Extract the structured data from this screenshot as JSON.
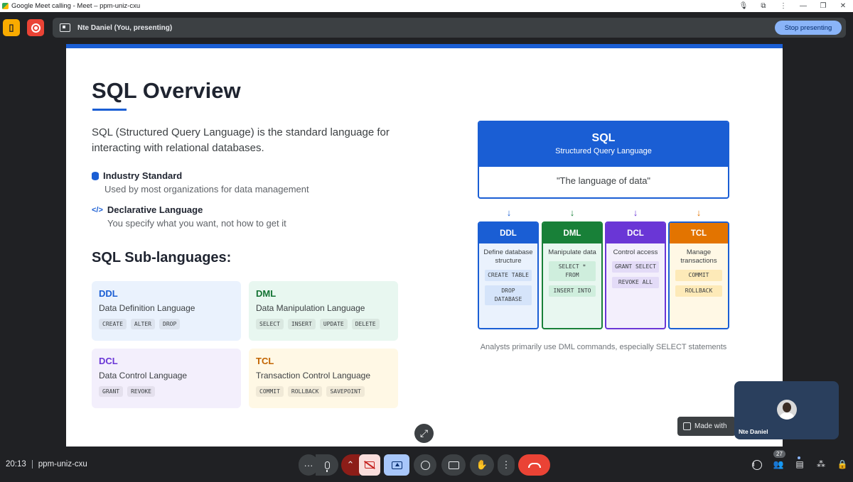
{
  "window": {
    "title": "Google Meet calling - Meet – ppm-uniz-cxu"
  },
  "presenting_bar": {
    "text": "Nte Daniel (You, presenting)",
    "stop_label": "Stop presenting"
  },
  "slide": {
    "title": "SQL Overview",
    "intro": "SQL (Structured Query Language) is the standard language for interacting with relational databases.",
    "features": [
      {
        "title": "Industry Standard",
        "desc": "Used by most organizations for data management",
        "icon": "database-icon"
      },
      {
        "title": "Declarative Language",
        "desc": "You specify what you want, not how to get it",
        "icon": "code-icon"
      }
    ],
    "sublang_heading": "SQL Sub-languages:",
    "cards": [
      {
        "abbr": "DDL",
        "name": "Data Definition Language",
        "chips": [
          "CREATE",
          "ALTER",
          "DROP"
        ]
      },
      {
        "abbr": "DML",
        "name": "Data Manipulation Language",
        "chips": [
          "SELECT",
          "INSERT",
          "UPDATE",
          "DELETE"
        ]
      },
      {
        "abbr": "DCL",
        "name": "Data Control Language",
        "chips": [
          "GRANT",
          "REVOKE"
        ]
      },
      {
        "abbr": "TCL",
        "name": "Transaction Control Language",
        "chips": [
          "COMMIT",
          "ROLLBACK",
          "SAVEPOINT"
        ]
      }
    ],
    "diagram": {
      "title": "SQL",
      "subtitle": "Structured Query Language",
      "quote": "\"The language of data\"",
      "arrow": "↓",
      "boxes": [
        {
          "head": "DDL",
          "desc": "Define database structure",
          "cmds": [
            "CREATE TABLE",
            "DROP DATABASE"
          ]
        },
        {
          "head": "DML",
          "desc": "Manipulate data",
          "cmds": [
            "SELECT * FROM",
            "INSERT INTO"
          ]
        },
        {
          "head": "DCL",
          "desc": "Control access",
          "cmds": [
            "GRANT SELECT",
            "REVOKE ALL"
          ]
        },
        {
          "head": "TCL",
          "desc": "Manage transactions",
          "cmds": [
            "COMMIT",
            "ROLLBACK"
          ]
        }
      ],
      "caption": "Analysts primarily use DML commands, especially SELECT statements"
    },
    "made_with": "Made with"
  },
  "self_tile": {
    "name": "Nte Daniel"
  },
  "bottom": {
    "time": "20:13",
    "meeting_code": "ppm-uniz-cxu",
    "participant_count": "27"
  },
  "colors": {
    "accent": "#1a5ed4",
    "ddl": "#1a5ed4",
    "dml": "#188038",
    "dcl": "#6a36d6",
    "tcl": "#e37400",
    "end_call": "#ea4335"
  }
}
